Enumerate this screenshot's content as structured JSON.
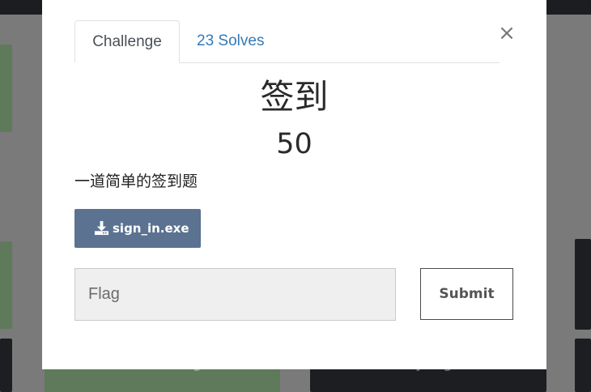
{
  "modal": {
    "tabs": {
      "challenge_label": "Challenge",
      "solves_label": "23 Solves"
    },
    "close_label": "×",
    "title": "签到",
    "points": "50",
    "description": "一道简单的签到题",
    "download": {
      "label": "sign_in.exe",
      "icon": "download-icon"
    },
    "flag_input": {
      "placeholder": "Flag",
      "value": ""
    },
    "submit_label": "Submit"
  },
  "background": {
    "card_labels": [
      "Misc... Flag",
      "Easy Login"
    ]
  },
  "colors": {
    "accent": "#337ab7",
    "download_button": "#5b7291",
    "card_green": "#5e7a5a",
    "card_dark": "#1c1e21",
    "overlay": "#7a7a7a"
  }
}
